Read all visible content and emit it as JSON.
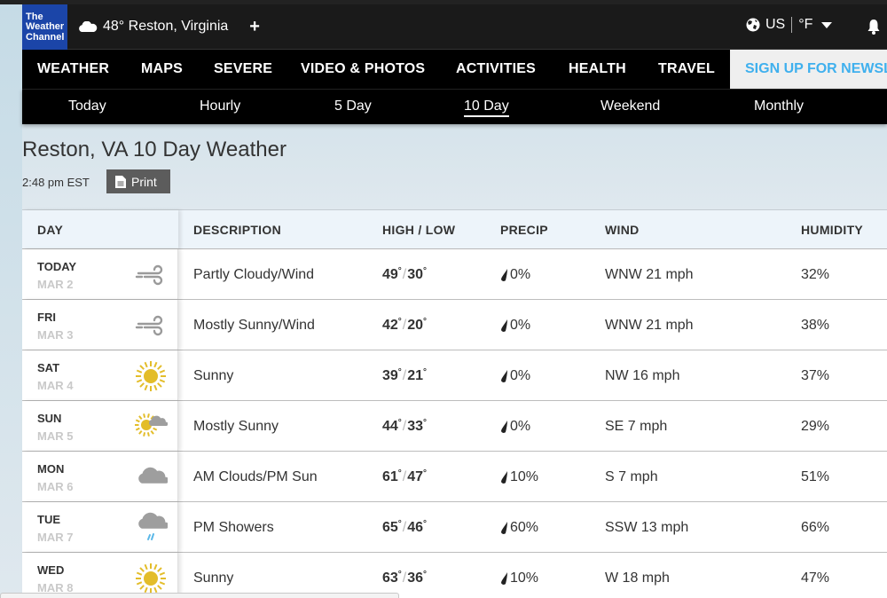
{
  "header": {
    "logo_lines": [
      "The",
      "Weather",
      "Channel"
    ],
    "current_conditions": {
      "icon": "cloud-icon",
      "text": "48° Reston, Virginia"
    },
    "add_location_icon": "plus-icon",
    "units": {
      "region": "US",
      "temp_unit": "°F"
    },
    "alerts_icon": "bell-icon"
  },
  "main_nav": {
    "items": [
      "WEATHER",
      "MAPS",
      "SEVERE",
      "VIDEO & PHOTOS",
      "ACTIVITIES",
      "HEALTH",
      "TRAVEL"
    ],
    "signup_label": "SIGN UP FOR NEWSLETTER",
    "signup_color": "#3fb0ee"
  },
  "sub_nav": {
    "items": [
      "Today",
      "Hourly",
      "5 Day",
      "10 Day",
      "Weekend",
      "Monthly"
    ],
    "active": "10 Day"
  },
  "page": {
    "title": "Reston, VA 10 Day Weather",
    "timestamp": "2:48 pm EST",
    "print_label": "Print"
  },
  "table": {
    "columns": [
      "DAY",
      "DESCRIPTION",
      "HIGH / LOW",
      "PRECIP",
      "WIND",
      "HUMIDITY"
    ],
    "rows": [
      {
        "day": "TODAY",
        "date": "MAR 2",
        "icon": "wind-icon",
        "description": "Partly Cloudy/Wind",
        "high": "49",
        "low": "30",
        "precip": "0%",
        "wind": "WNW 21 mph",
        "humidity": "32%"
      },
      {
        "day": "FRI",
        "date": "MAR 3",
        "icon": "wind-icon",
        "description": "Mostly Sunny/Wind",
        "high": "42",
        "low": "20",
        "precip": "0%",
        "wind": "WNW 21 mph",
        "humidity": "38%"
      },
      {
        "day": "SAT",
        "date": "MAR 4",
        "icon": "sun-icon",
        "description": "Sunny",
        "high": "39",
        "low": "21",
        "precip": "0%",
        "wind": "NW 16 mph",
        "humidity": "37%"
      },
      {
        "day": "SUN",
        "date": "MAR 5",
        "icon": "mostly-sunny-icon",
        "description": "Mostly Sunny",
        "high": "44",
        "low": "33",
        "precip": "0%",
        "wind": "SE 7 mph",
        "humidity": "29%"
      },
      {
        "day": "MON",
        "date": "MAR 6",
        "icon": "cloud-icon",
        "description": "AM Clouds/PM Sun",
        "high": "61",
        "low": "47",
        "precip": "10%",
        "wind": "S 7 mph",
        "humidity": "51%"
      },
      {
        "day": "TUE",
        "date": "MAR 7",
        "icon": "rain-shower-icon",
        "description": "PM Showers",
        "high": "65",
        "low": "46",
        "precip": "60%",
        "wind": "SSW 13 mph",
        "humidity": "66%"
      },
      {
        "day": "WED",
        "date": "MAR 8",
        "icon": "sun-icon",
        "description": "Sunny",
        "high": "63",
        "low": "36",
        "precip": "10%",
        "wind": "W 18 mph",
        "humidity": "47%"
      }
    ]
  },
  "colors": {
    "logo_bg": "#1b45a8",
    "sun": "#e3bd2a",
    "cloud": "#9e9e9e",
    "rain": "#5bb8e8"
  }
}
